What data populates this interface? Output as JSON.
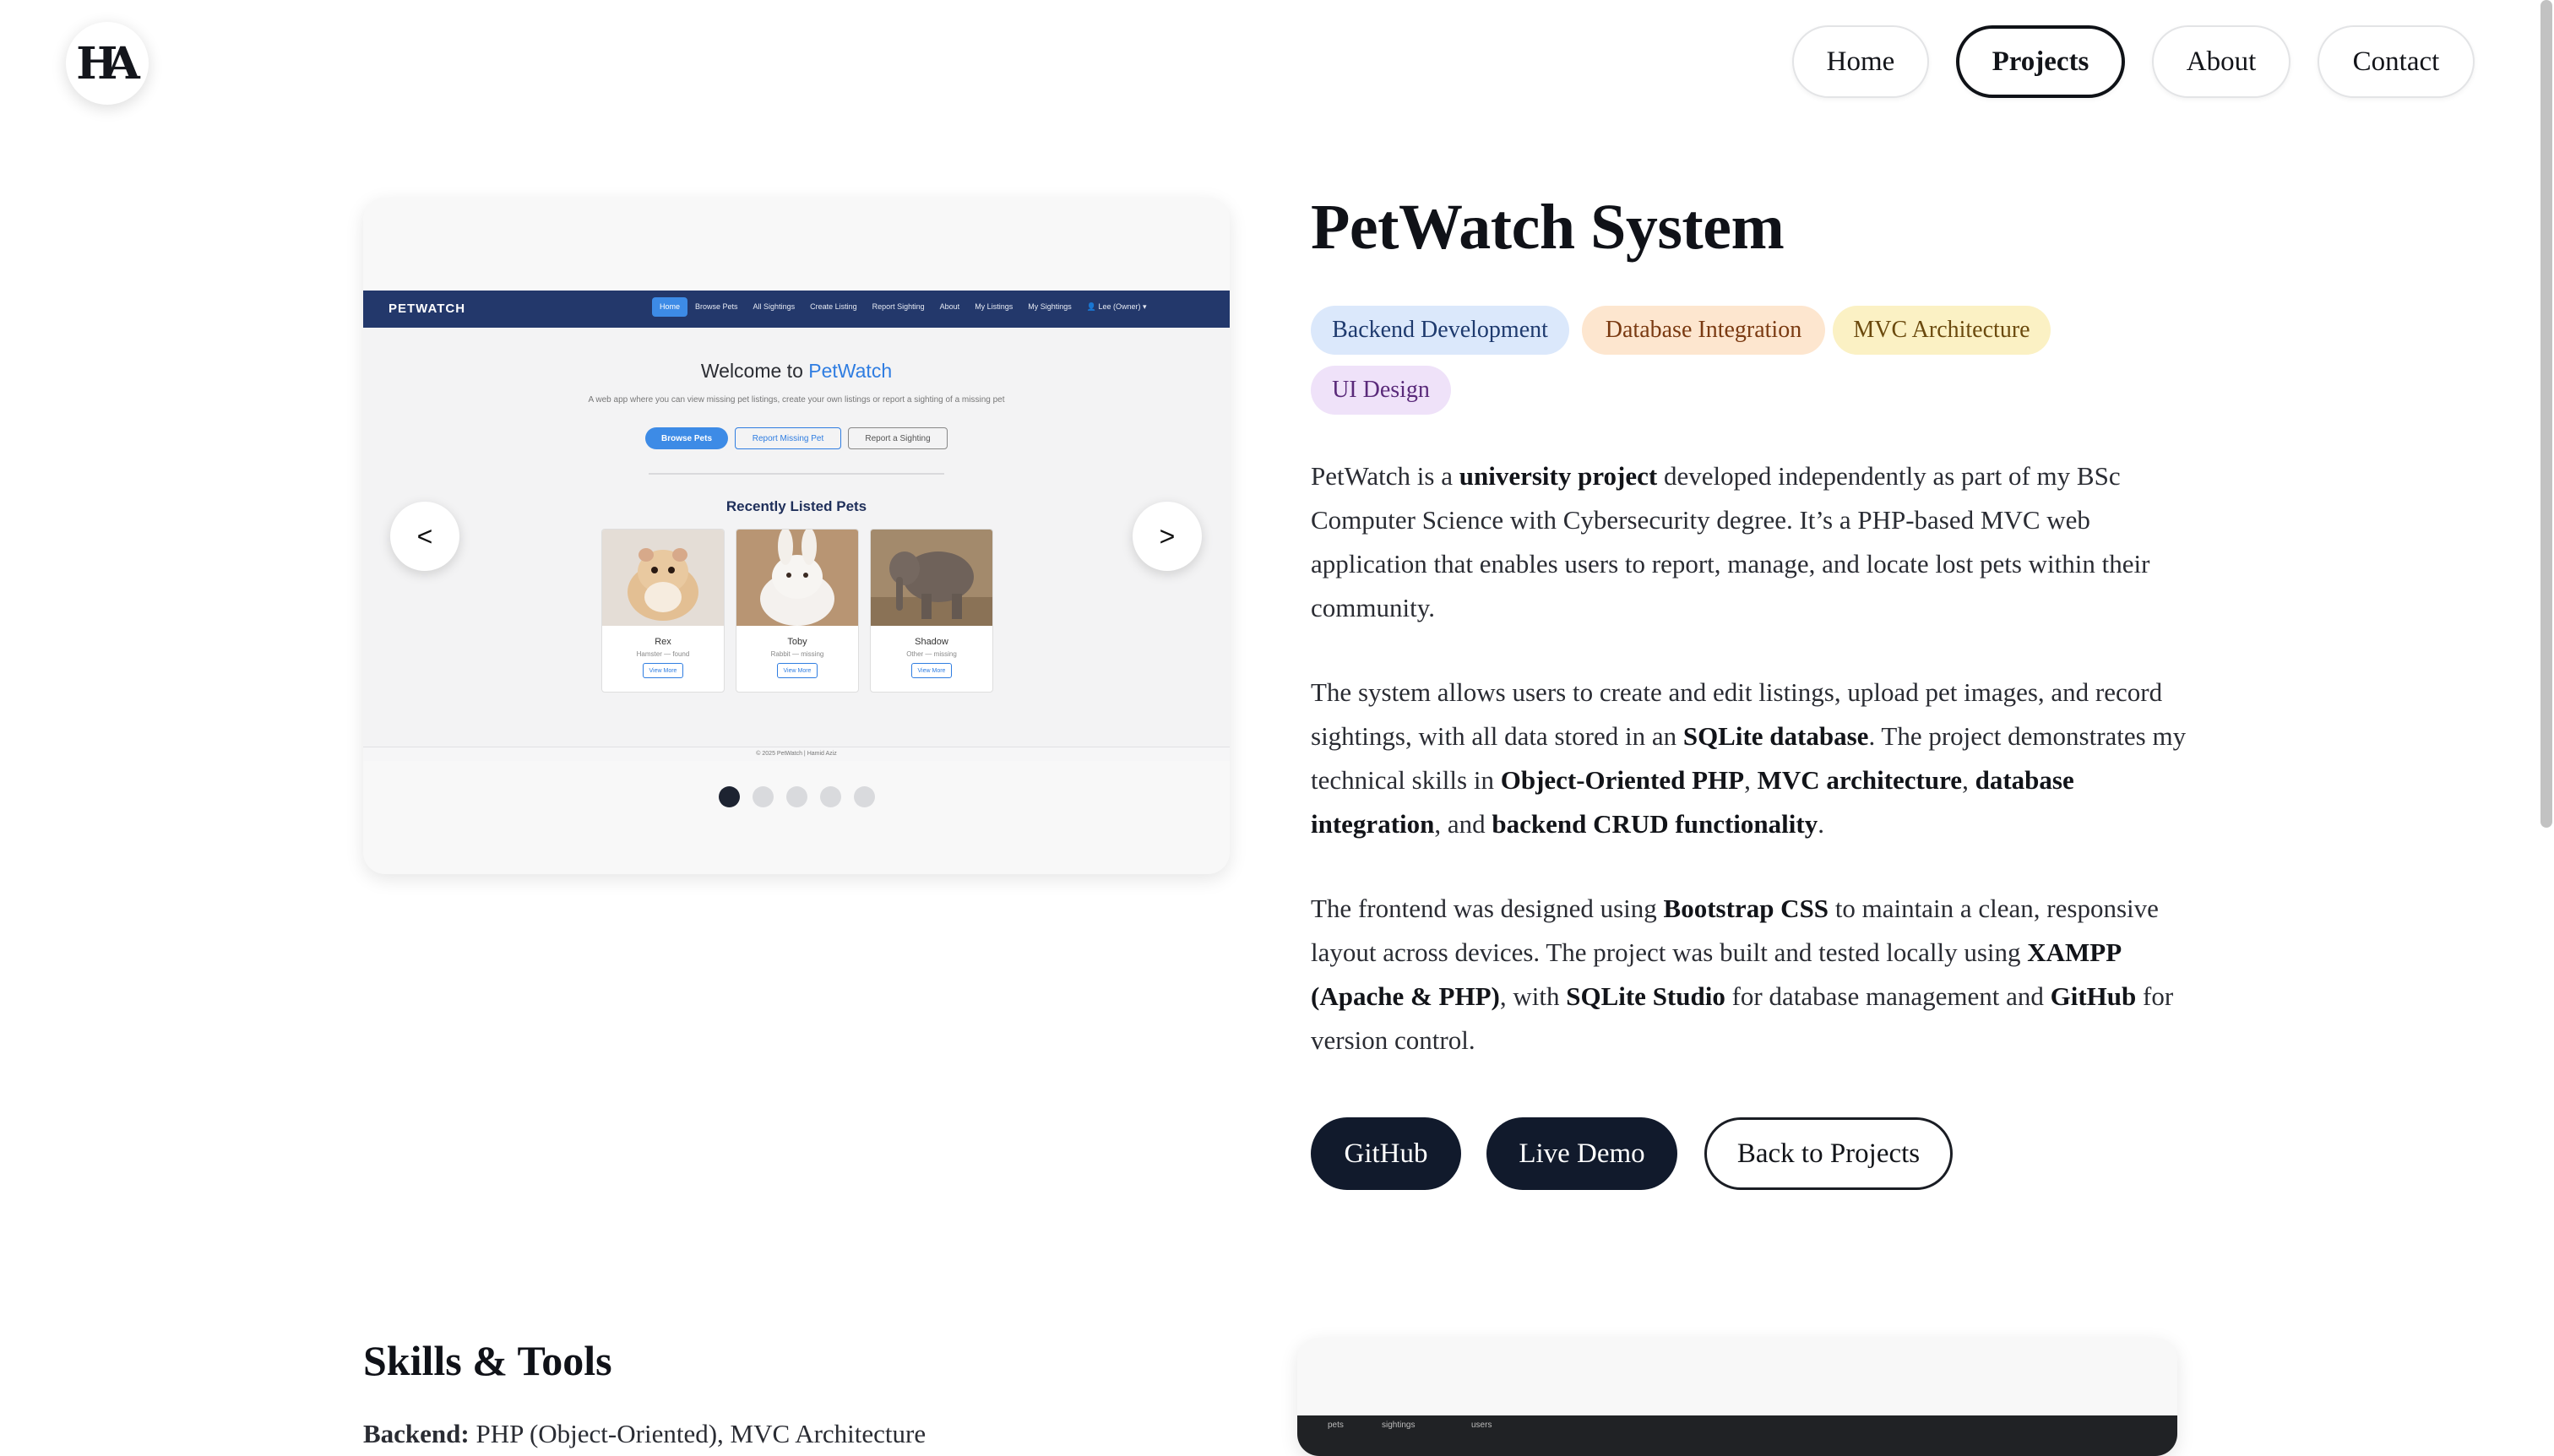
{
  "nav": {
    "logo_text": "HA",
    "items": [
      {
        "label": "Home",
        "active": false
      },
      {
        "label": "Projects",
        "active": true
      },
      {
        "label": "About",
        "active": false
      },
      {
        "label": "Contact",
        "active": false
      }
    ]
  },
  "carousel": {
    "prev_label": "<",
    "next_label": ">",
    "slide_count": 5,
    "active_slide": 1,
    "screenshot": {
      "brand": "PETWATCH",
      "nav_links": [
        "Home",
        "Browse Pets",
        "All Sightings",
        "Create Listing",
        "Report Sighting",
        "About",
        "My Listings",
        "My Sightings",
        "👤 Lee (Owner) ▾"
      ],
      "welcome_prefix": "Welcome to",
      "welcome_brand": "PetWatch",
      "tagline": "A web app where you can view missing pet listings, create your own listings or report a sighting of a missing pet",
      "buttons": [
        "Browse Pets",
        "Report Missing Pet",
        "Report a Sighting"
      ],
      "recent_heading": "Recently Listed Pets",
      "pets": [
        {
          "name": "Rex",
          "status": "Hamster — found",
          "button": "View More"
        },
        {
          "name": "Toby",
          "status": "Rabbit — missing",
          "button": "View More"
        },
        {
          "name": "Shadow",
          "status": "Other — missing",
          "button": "View More"
        }
      ],
      "footer": "© 2025 PetWatch | Hamid Aziz"
    }
  },
  "project": {
    "title": "PetWatch System",
    "tags": [
      {
        "label": "Backend Development",
        "bg": "#dbe8fb",
        "fg": "#1e3a6e"
      },
      {
        "label": "Database Integration",
        "bg": "#fde6cf",
        "fg": "#7a3a12"
      },
      {
        "label": "MVC Architecture",
        "bg": "#fbf1c4",
        "fg": "#6b4a0e"
      },
      {
        "label": "UI Design",
        "bg": "#efe2f9",
        "fg": "#5a2a7a"
      }
    ],
    "para1": {
      "t1": "PetWatch is a ",
      "b1": "university project",
      "t2": " developed independently as part of my BSc Computer Science with Cybersecurity degree. It’s a PHP-based MVC web application that enables users to report, manage, and locate lost pets within their community."
    },
    "para2": {
      "t1": "The system allows users to create and edit listings, upload pet images, and record sightings, with all data stored in an ",
      "b1": "SQLite database",
      "t2": ". The project demonstrates my technical skills in ",
      "b2": "Object-Oriented PHP",
      "t3": ", ",
      "b3": "MVC architecture",
      "t4": ", ",
      "b4": "database integration",
      "t5": ", and ",
      "b5": "backend CRUD functionality",
      "t6": "."
    },
    "para3": {
      "t1": "The frontend was designed using ",
      "b1": "Bootstrap CSS",
      "t2": " to maintain a clean, responsive layout across devices. The project was built and tested locally using ",
      "b2": "XAMPP (Apache & PHP)",
      "t3": ", with ",
      "b3": "SQLite Studio",
      "t4": " for database management and ",
      "b4": "GitHub",
      "t5": " for version control."
    },
    "buttons": {
      "github": "GitHub",
      "demo": "Live Demo",
      "back": "Back to Projects"
    }
  },
  "skills": {
    "heading": "Skills & Tools",
    "first_label": "Backend:",
    "first_text": " PHP (Object-Oriented), MVC Architecture"
  },
  "second_card": {
    "tabs": [
      "pets",
      "sightings",
      "users"
    ]
  }
}
